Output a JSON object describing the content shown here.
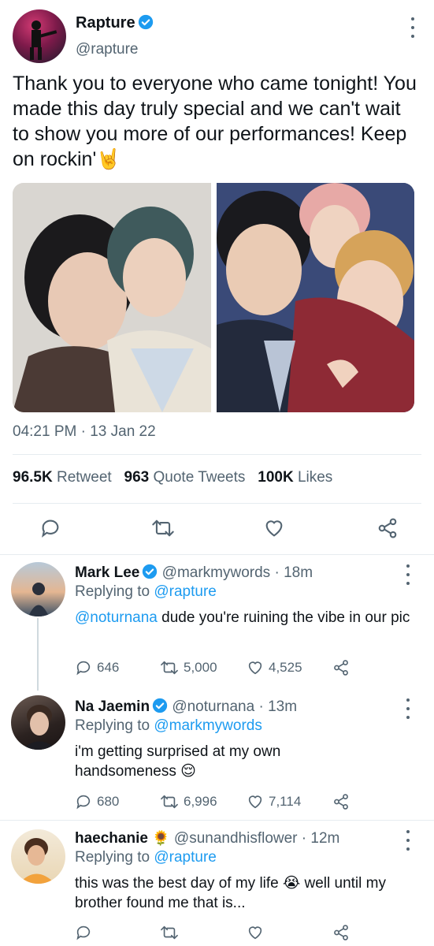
{
  "tweet": {
    "author_name": "Rapture",
    "author_handle": "@rapture",
    "text": "Thank you to everyone who came tonight! You made this day truly special and we can't wait to show you more of our performances! Keep on rockin'",
    "text_emoji": "🤘",
    "time": "04:21 PM",
    "date": "13 Jan 22",
    "date_separator": "·",
    "stats": {
      "retweets_value": "96.5K",
      "retweets_label": "Retweet",
      "quotes_value": "963",
      "quotes_label": "Quote Tweets",
      "likes_value": "100K",
      "likes_label": "Likes"
    },
    "colors": {
      "accent": "#1d9bf0",
      "verified": "#1d9bf0"
    }
  },
  "replies": [
    {
      "name": "Mark Lee",
      "handle": "@markmywords",
      "time": "· 18m",
      "replying_label": "Replying to",
      "replying_to": "@rapture",
      "mention": "@noturnana",
      "text": " dude you're ruining the vibe in our pic",
      "replies": "646",
      "retweets": "5,000",
      "likes": "4,525"
    },
    {
      "name": "Na Jaemin",
      "handle": "@noturnana",
      "time": "· 13m",
      "replying_label": "Replying to",
      "replying_to": "@markmywords",
      "text": "i'm getting surprised at my own handsomeness",
      "text_emoji": "😌",
      "replies": "680",
      "retweets": "6,996",
      "likes": "7,114"
    },
    {
      "name": "haechanie",
      "name_emoji": "🌻",
      "handle": "@sunandhisflower",
      "time": "· 12m",
      "replying_label": "Replying to",
      "replying_to": "@rapture",
      "text_part1": "this was the best day of my life",
      "text_emoji": "😭",
      "text_part2": "well until my brother found me that is..."
    }
  ]
}
